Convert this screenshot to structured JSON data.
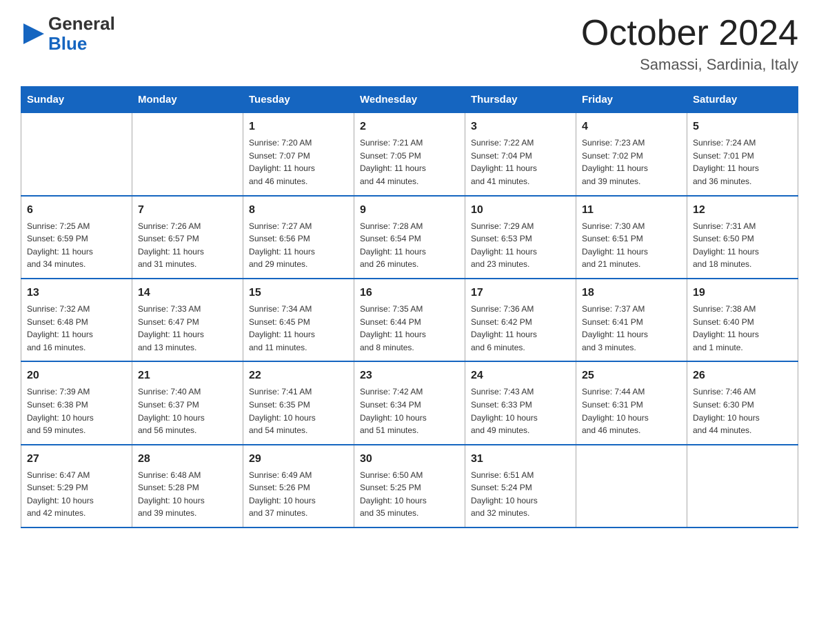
{
  "header": {
    "logo_general": "General",
    "logo_blue": "Blue",
    "title": "October 2024",
    "subtitle": "Samassi, Sardinia, Italy"
  },
  "calendar": {
    "days_of_week": [
      "Sunday",
      "Monday",
      "Tuesday",
      "Wednesday",
      "Thursday",
      "Friday",
      "Saturday"
    ],
    "weeks": [
      [
        {
          "day": "",
          "info": ""
        },
        {
          "day": "",
          "info": ""
        },
        {
          "day": "1",
          "info": "Sunrise: 7:20 AM\nSunset: 7:07 PM\nDaylight: 11 hours\nand 46 minutes."
        },
        {
          "day": "2",
          "info": "Sunrise: 7:21 AM\nSunset: 7:05 PM\nDaylight: 11 hours\nand 44 minutes."
        },
        {
          "day": "3",
          "info": "Sunrise: 7:22 AM\nSunset: 7:04 PM\nDaylight: 11 hours\nand 41 minutes."
        },
        {
          "day": "4",
          "info": "Sunrise: 7:23 AM\nSunset: 7:02 PM\nDaylight: 11 hours\nand 39 minutes."
        },
        {
          "day": "5",
          "info": "Sunrise: 7:24 AM\nSunset: 7:01 PM\nDaylight: 11 hours\nand 36 minutes."
        }
      ],
      [
        {
          "day": "6",
          "info": "Sunrise: 7:25 AM\nSunset: 6:59 PM\nDaylight: 11 hours\nand 34 minutes."
        },
        {
          "day": "7",
          "info": "Sunrise: 7:26 AM\nSunset: 6:57 PM\nDaylight: 11 hours\nand 31 minutes."
        },
        {
          "day": "8",
          "info": "Sunrise: 7:27 AM\nSunset: 6:56 PM\nDaylight: 11 hours\nand 29 minutes."
        },
        {
          "day": "9",
          "info": "Sunrise: 7:28 AM\nSunset: 6:54 PM\nDaylight: 11 hours\nand 26 minutes."
        },
        {
          "day": "10",
          "info": "Sunrise: 7:29 AM\nSunset: 6:53 PM\nDaylight: 11 hours\nand 23 minutes."
        },
        {
          "day": "11",
          "info": "Sunrise: 7:30 AM\nSunset: 6:51 PM\nDaylight: 11 hours\nand 21 minutes."
        },
        {
          "day": "12",
          "info": "Sunrise: 7:31 AM\nSunset: 6:50 PM\nDaylight: 11 hours\nand 18 minutes."
        }
      ],
      [
        {
          "day": "13",
          "info": "Sunrise: 7:32 AM\nSunset: 6:48 PM\nDaylight: 11 hours\nand 16 minutes."
        },
        {
          "day": "14",
          "info": "Sunrise: 7:33 AM\nSunset: 6:47 PM\nDaylight: 11 hours\nand 13 minutes."
        },
        {
          "day": "15",
          "info": "Sunrise: 7:34 AM\nSunset: 6:45 PM\nDaylight: 11 hours\nand 11 minutes."
        },
        {
          "day": "16",
          "info": "Sunrise: 7:35 AM\nSunset: 6:44 PM\nDaylight: 11 hours\nand 8 minutes."
        },
        {
          "day": "17",
          "info": "Sunrise: 7:36 AM\nSunset: 6:42 PM\nDaylight: 11 hours\nand 6 minutes."
        },
        {
          "day": "18",
          "info": "Sunrise: 7:37 AM\nSunset: 6:41 PM\nDaylight: 11 hours\nand 3 minutes."
        },
        {
          "day": "19",
          "info": "Sunrise: 7:38 AM\nSunset: 6:40 PM\nDaylight: 11 hours\nand 1 minute."
        }
      ],
      [
        {
          "day": "20",
          "info": "Sunrise: 7:39 AM\nSunset: 6:38 PM\nDaylight: 10 hours\nand 59 minutes."
        },
        {
          "day": "21",
          "info": "Sunrise: 7:40 AM\nSunset: 6:37 PM\nDaylight: 10 hours\nand 56 minutes."
        },
        {
          "day": "22",
          "info": "Sunrise: 7:41 AM\nSunset: 6:35 PM\nDaylight: 10 hours\nand 54 minutes."
        },
        {
          "day": "23",
          "info": "Sunrise: 7:42 AM\nSunset: 6:34 PM\nDaylight: 10 hours\nand 51 minutes."
        },
        {
          "day": "24",
          "info": "Sunrise: 7:43 AM\nSunset: 6:33 PM\nDaylight: 10 hours\nand 49 minutes."
        },
        {
          "day": "25",
          "info": "Sunrise: 7:44 AM\nSunset: 6:31 PM\nDaylight: 10 hours\nand 46 minutes."
        },
        {
          "day": "26",
          "info": "Sunrise: 7:46 AM\nSunset: 6:30 PM\nDaylight: 10 hours\nand 44 minutes."
        }
      ],
      [
        {
          "day": "27",
          "info": "Sunrise: 6:47 AM\nSunset: 5:29 PM\nDaylight: 10 hours\nand 42 minutes."
        },
        {
          "day": "28",
          "info": "Sunrise: 6:48 AM\nSunset: 5:28 PM\nDaylight: 10 hours\nand 39 minutes."
        },
        {
          "day": "29",
          "info": "Sunrise: 6:49 AM\nSunset: 5:26 PM\nDaylight: 10 hours\nand 37 minutes."
        },
        {
          "day": "30",
          "info": "Sunrise: 6:50 AM\nSunset: 5:25 PM\nDaylight: 10 hours\nand 35 minutes."
        },
        {
          "day": "31",
          "info": "Sunrise: 6:51 AM\nSunset: 5:24 PM\nDaylight: 10 hours\nand 32 minutes."
        },
        {
          "day": "",
          "info": ""
        },
        {
          "day": "",
          "info": ""
        }
      ]
    ]
  }
}
